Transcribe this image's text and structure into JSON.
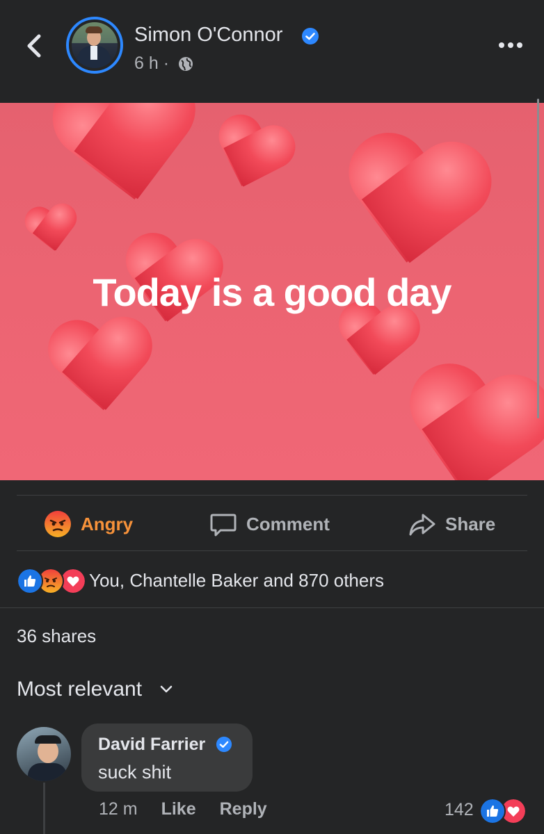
{
  "header": {
    "author_name": "Simon O'Connor",
    "time": "6 h ·"
  },
  "post": {
    "text": "Today is a good day"
  },
  "actions": {
    "angry_label": "Angry",
    "comment_label": "Comment",
    "share_label": "Share"
  },
  "reactions_summary": "You, Chantelle Baker and 870 others",
  "shares": "36 shares",
  "sort_label": "Most relevant",
  "comment": {
    "author": "David Farrier",
    "text": "suck shit",
    "time": "12 m",
    "like_label": "Like",
    "reply_label": "Reply",
    "reaction_count": "142"
  },
  "colors": {
    "background": "#242526",
    "accent_blue": "#2d88ff",
    "angry_orange": "#f7923a",
    "post_pink": "#ec6472"
  },
  "icons": [
    "back-arrow-icon",
    "verified-badge-icon",
    "globe-icon",
    "more-icon",
    "angry-icon",
    "comment-icon",
    "share-icon",
    "like-reaction-icon",
    "love-reaction-icon",
    "chevron-down-icon"
  ]
}
